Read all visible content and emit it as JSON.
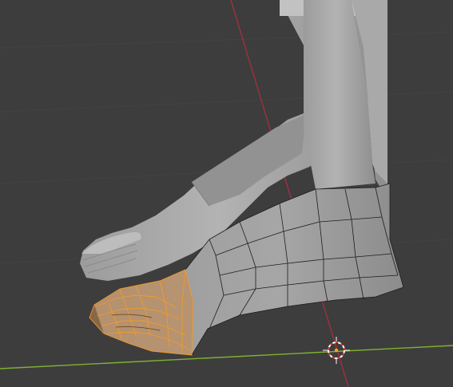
{
  "viewport": {
    "background": "#3d3d3d",
    "grid_line_color": "#434343",
    "x_axis_color": "#a0303d",
    "y_axis_color": "#7fb132",
    "mesh_color": "#a7a7a7",
    "mesh_shadow_color": "#8f8f8f",
    "wire_color": "#1d1d1d",
    "selection_color": "#f29a2b",
    "selection_fill": "#c9894a",
    "cursor_color": "#ffffff",
    "objects": [
      "leg-foot-mesh",
      "shoe-mesh-wireframe",
      "selected-toe-faces"
    ],
    "mode": "edit-mode",
    "cursor": "3d-cursor-icon"
  }
}
